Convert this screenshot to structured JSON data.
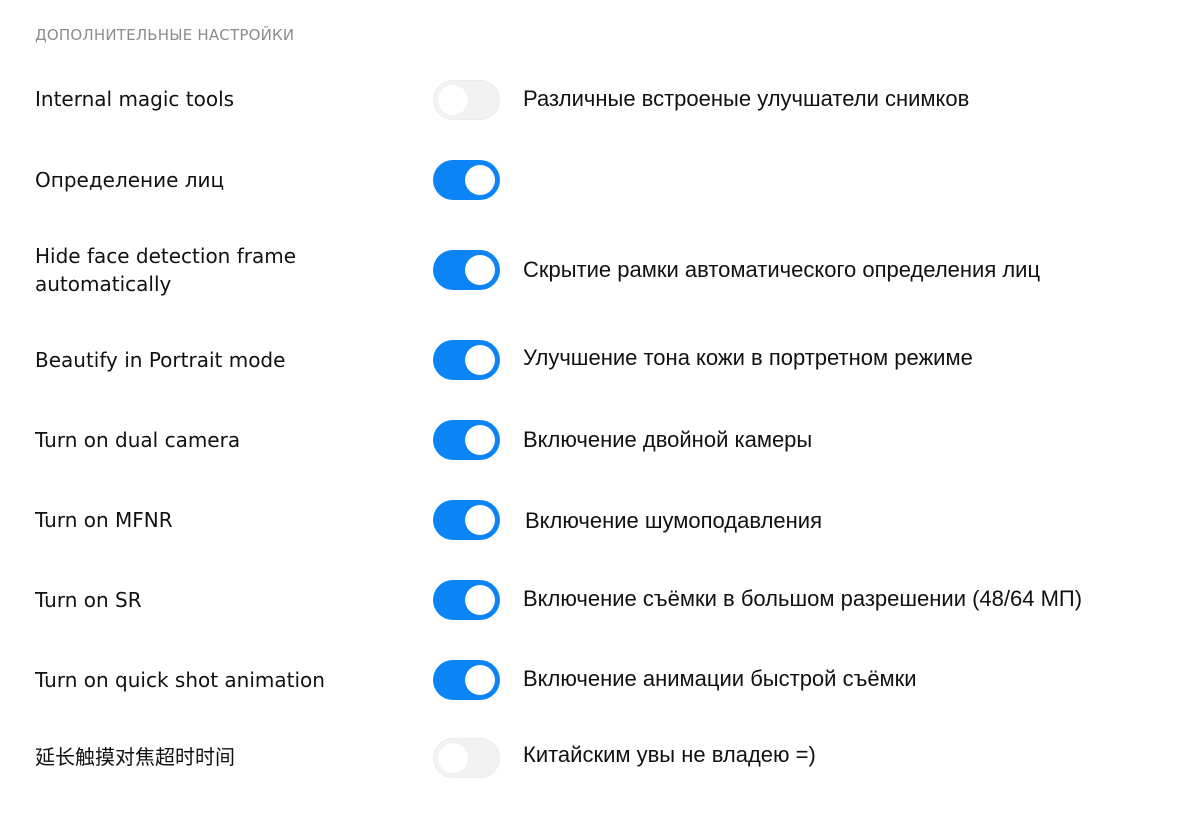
{
  "section": {
    "title": "ДОПОЛНИТЕЛЬНЫЕ НАСТРОЙКИ"
  },
  "colors": {
    "accent": "#0d84f5",
    "toggle_off": "#f2f2f2",
    "section_title": "#8c8c8c"
  },
  "settings": [
    {
      "label": "Internal magic tools",
      "enabled": false,
      "description": "Различные встроеные улучшатели снимков"
    },
    {
      "label": "Определение лиц",
      "enabled": true,
      "description": ""
    },
    {
      "label": "Hide face detection frame automatically",
      "enabled": true,
      "description": "Скрытие рамки автоматического определения лиц"
    },
    {
      "label": "Beautify in Portrait mode",
      "enabled": true,
      "description": "Улучшение тона кожи в портретном режиме"
    },
    {
      "label": "Turn on dual camera",
      "enabled": true,
      "description": "Включение двойной камеры"
    },
    {
      "label": "Turn on MFNR",
      "enabled": true,
      "description": "Включение шумоподавления"
    },
    {
      "label": "Turn on SR",
      "enabled": true,
      "description": "Включение съёмки в большом разрешении (48/64 МП)"
    },
    {
      "label": "Turn on quick shot animation",
      "enabled": true,
      "description": "Включение анимации быстрой съёмки"
    },
    {
      "label": "延长触摸对焦超时时间",
      "enabled": false,
      "description": "Китайским увы не владею =)"
    }
  ]
}
